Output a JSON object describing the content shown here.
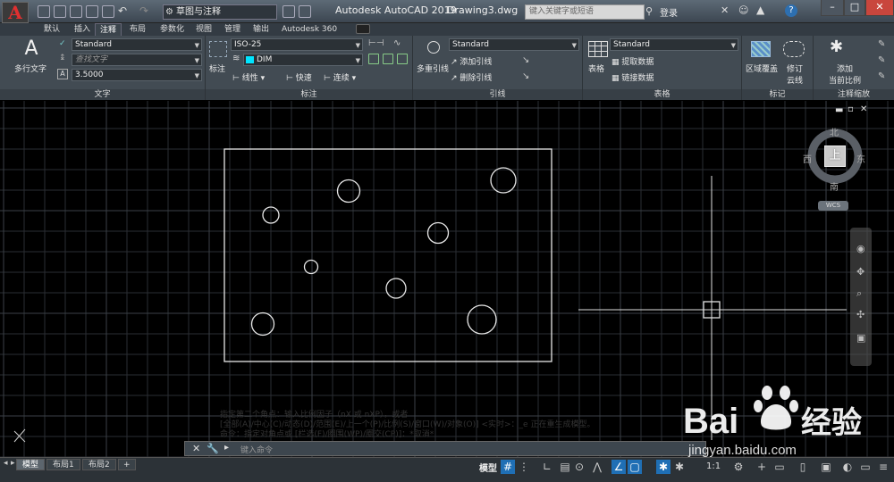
{
  "title_bar": {
    "workspace": "草图与注释",
    "app_title": "Autodesk AutoCAD 2019",
    "document": "Drawing3.dwg",
    "search_placeholder": "键入关键字或短语",
    "login": "登录"
  },
  "tabs": [
    {
      "label": "默认"
    },
    {
      "label": "插入"
    },
    {
      "label": "注释",
      "active": true
    },
    {
      "label": "布局"
    },
    {
      "label": "参数化"
    },
    {
      "label": "视图"
    },
    {
      "label": "管理"
    },
    {
      "label": "输出"
    },
    {
      "label": "Autodesk 360"
    }
  ],
  "ribbon": {
    "text_panel": {
      "big_button": "多行文字",
      "style": "Standard",
      "find_placeholder": "查找文字",
      "height": "3.5000",
      "label": "文字"
    },
    "dim_panel": {
      "big_button": "标注",
      "style": "ISO-25",
      "layer": "DIM",
      "linear": "线性",
      "quick": "快速",
      "continue": "连续",
      "label": "标注"
    },
    "leader_panel": {
      "big_button": "多重引线",
      "style": "Standard",
      "add": "添加引线",
      "remove": "删除引线",
      "label": "引线"
    },
    "table_panel": {
      "big_button": "表格",
      "style": "Standard",
      "extract": "提取数据",
      "link": "链接数据",
      "label": "表格"
    },
    "mark_panel": {
      "wipeout": "区域覆盖",
      "revcloud_line1": "修订",
      "revcloud_line2": "云线",
      "label": "标记"
    },
    "scale_panel": {
      "add_line1": "添加",
      "add_line2": "当前比例",
      "label": "注释缩放"
    }
  },
  "viewcube": {
    "north": "北",
    "south": "南",
    "east": "东",
    "west": "西",
    "face": "上",
    "wcs": "WCS"
  },
  "command": {
    "history": [
      "指定第二个角点：输入比例因子（nX 或 nXP），或者",
      "[全部(A)/中心(C)/动态(D)/范围(E)/上一个(P)/比例(S)/窗口(W)/对象(O)] <实时>：_e 正在重生成模型。",
      "命令：指定对角点或 [栏选(F)/圈围(WP)/圈交(CP)]：*取消*"
    ],
    "placeholder": "键入命令"
  },
  "layout_tabs": [
    {
      "label": "模型",
      "active": true
    },
    {
      "label": "布局1"
    },
    {
      "label": "布局2"
    }
  ],
  "status": {
    "model": "模型",
    "scale": "1:1"
  },
  "watermark": {
    "brand": "Bai",
    "brand2": "经验",
    "url": "jingyan.baidu.com"
  },
  "colors": {
    "accent": "#1f6fb5",
    "dim_layer_swatch": "#00e5ff",
    "logo_red": "#e03030"
  }
}
